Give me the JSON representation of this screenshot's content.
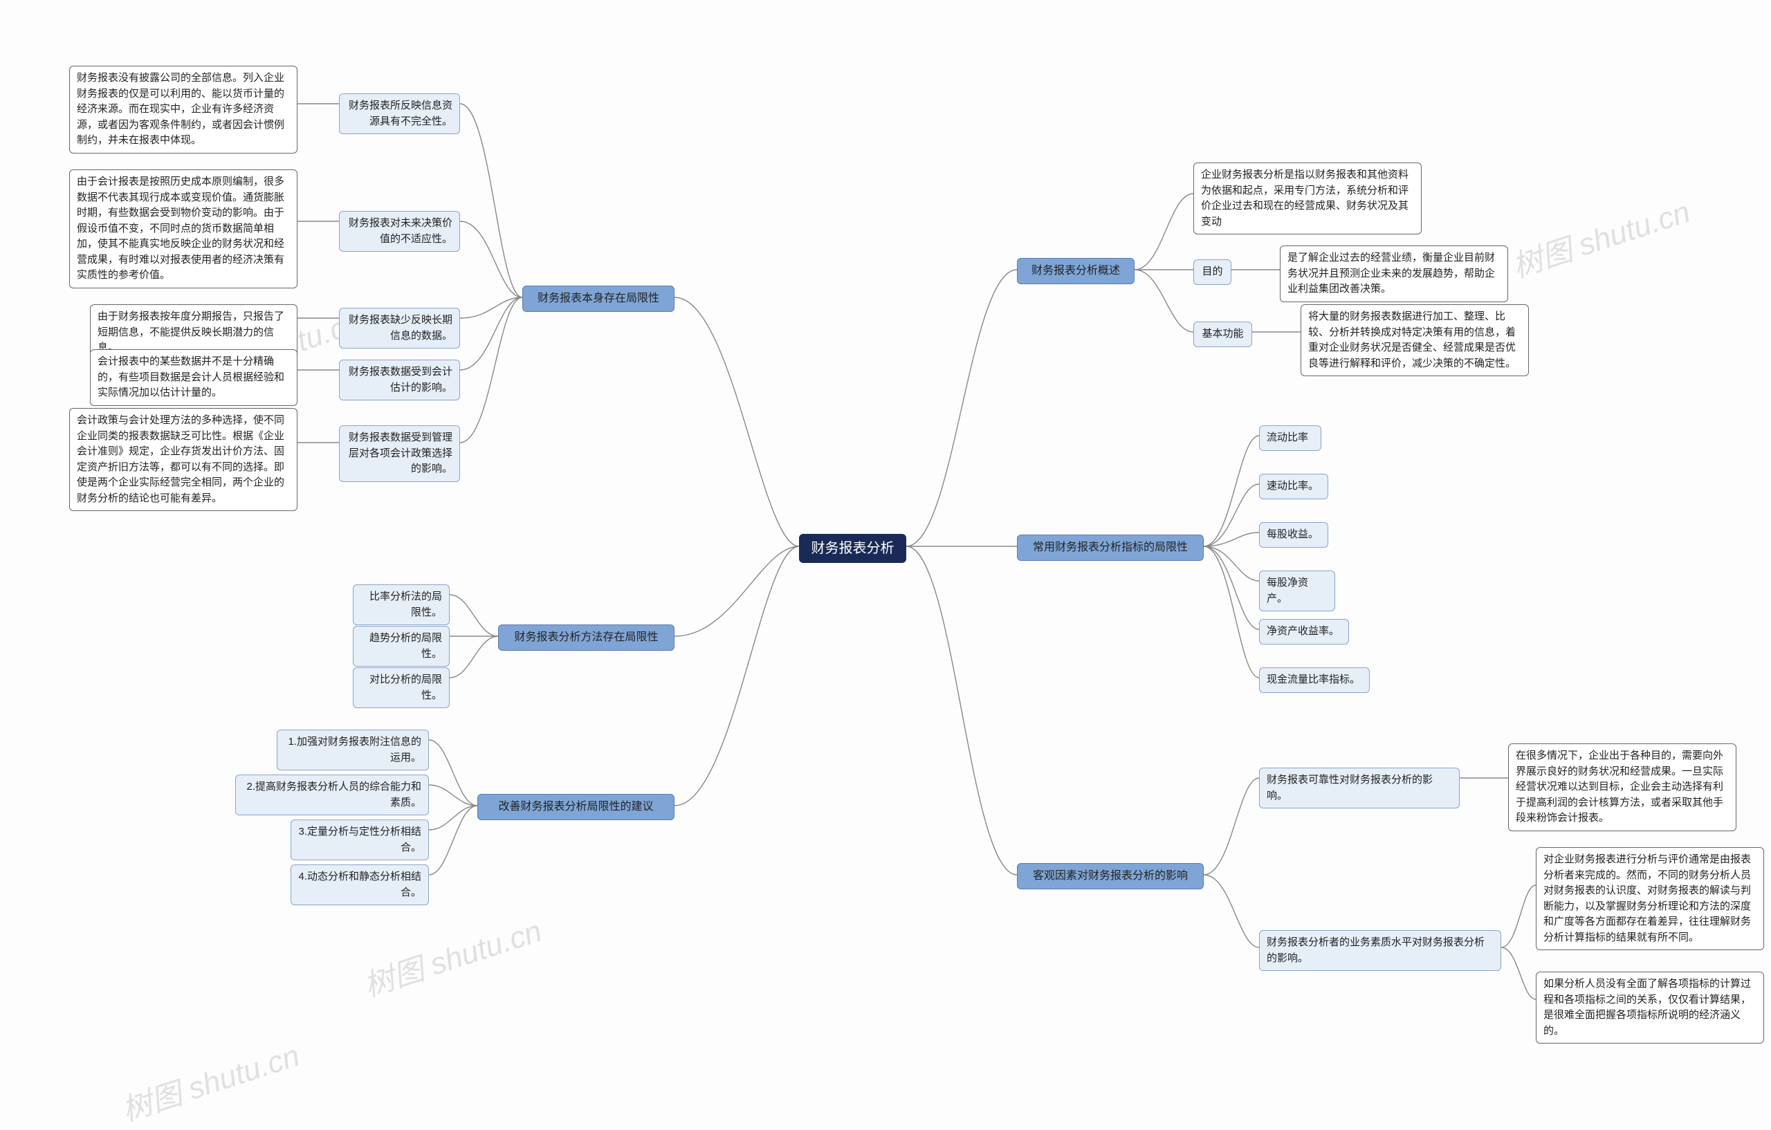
{
  "watermark": "树图 shutu.cn",
  "root": "财务报表分析",
  "left": {
    "b1": {
      "label": "财务报表本身存在局限性",
      "children": [
        {
          "label": "财务报表所反映信息资源具有不完全性。",
          "detail": "财务报表没有披露公司的全部信息。列入企业财务报表的仅是可以利用的、能以货币计量的经济来源。而在现实中，企业有许多经济资源，或者因为客观条件制约，或者因会计惯例制约，并未在报表中体现。"
        },
        {
          "label": "财务报表对未来决策价值的不适应性。",
          "detail": "由于会计报表是按照历史成本原则编制，很多数据不代表其现行成本或变现价值。通货膨胀时期，有些数据会受到物价变动的影响。由于假设币值不变，不同时点的货币数据简单相加，使其不能真实地反映企业的财务状况和经营成果，有时难以对报表使用者的经济决策有实质性的参考价值。"
        },
        {
          "label": "财务报表缺少反映长期信息的数据。",
          "detail": "由于财务报表按年度分期报告，只报告了短期信息，不能提供反映长期潜力的信息。"
        },
        {
          "label": "财务报表数据受到会计估计的影响。",
          "detail": "会计报表中的某些数据并不是十分精确的，有些项目数据是会计人员根据经验和实际情况加以估计计量的。"
        },
        {
          "label": "财务报表数据受到管理层对各项会计政策选择的影响。",
          "detail": "会计政策与会计处理方法的多种选择，使不同企业同类的报表数据缺乏可比性。根据《企业会计准则》规定，企业存货发出计价方法、固定资产折旧方法等，都可以有不同的选择。即使是两个企业实际经营完全相同，两个企业的财务分析的结论也可能有差异。"
        }
      ]
    },
    "b2": {
      "label": "财务报表分析方法存在局限性",
      "children": [
        {
          "label": "比率分析法的局限性。"
        },
        {
          "label": "趋势分析的局限性。"
        },
        {
          "label": "对比分析的局限性。"
        }
      ]
    },
    "b3": {
      "label": "改善财务报表分析局限性的建议",
      "children": [
        {
          "label": "1.加强对财务报表附注信息的运用。"
        },
        {
          "label": "2.提高财务报表分析人员的综合能力和素质。"
        },
        {
          "label": "3.定量分析与定性分析相结合。"
        },
        {
          "label": "4.动态分析和静态分析相结合。"
        }
      ]
    }
  },
  "right": {
    "b1": {
      "label": "财务报表分析概述",
      "children": [
        {
          "label": "企业财务报表分析是指以财务报表和其他资料为依据和起点，采用专门方法，系统分析和评价企业过去和现在的经营成果、财务状况及其变动"
        },
        {
          "label": "目的",
          "detail": "是了解企业过去的经营业绩，衡量企业目前财务状况并且预测企业未来的发展趋势，帮助企业利益集团改善决策。"
        },
        {
          "label": "基本功能",
          "detail": "将大量的财务报表数据进行加工、整理、比较、分析并转换成对特定决策有用的信息，着重对企业财务状况是否健全、经营成果是否优良等进行解释和评价，减少决策的不确定性。"
        }
      ]
    },
    "b2": {
      "label": "常用财务报表分析指标的局限性",
      "children": [
        {
          "label": "流动比率"
        },
        {
          "label": "速动比率。"
        },
        {
          "label": "每股收益。"
        },
        {
          "label": "每股净资产。"
        },
        {
          "label": "净资产收益率。"
        },
        {
          "label": "现金流量比率指标。"
        }
      ]
    },
    "b3": {
      "label": "客观因素对财务报表分析的影响",
      "children": [
        {
          "label": "财务报表可靠性对财务报表分析的影响。",
          "detail": "在很多情况下，企业出于各种目的，需要向外界展示良好的财务状况和经营成果。一旦实际经营状况难以达到目标，企业会主动选择有利于提高利润的会计核算方法，或者采取其他手段来粉饰会计报表。"
        },
        {
          "label": "财务报表分析者的业务素质水平对财务报表分析的影响。",
          "details": [
            "对企业财务报表进行分析与评价通常是由报表分析者来完成的。然而，不同的财务分析人员对财务报表的认识度、对财务报表的解读与判断能力，以及掌握财务分析理论和方法的深度和广度等各方面都存在着差异，往往理解财务分析计算指标的结果就有所不同。",
            "如果分析人员没有全面了解各项指标的计算过程和各项指标之间的关系，仅仅看计算结果，是很难全面把握各项指标所说明的经济涵义的。"
          ]
        }
      ]
    }
  }
}
